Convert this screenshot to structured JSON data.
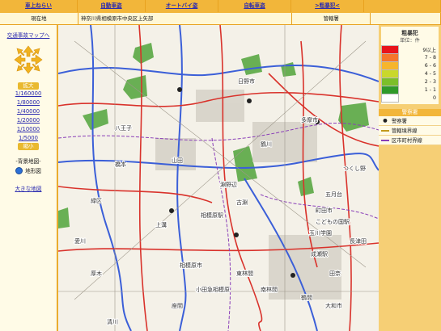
{
  "tabs": [
    "車上ねらい",
    "自動車盗",
    "オートバイ盗",
    "自転車盗",
    ">粗暴犯<"
  ],
  "location": {
    "label": "現在地",
    "value": "神奈川県相模原市中央区上矢部",
    "station_label": "管轄署",
    "station_value": ""
  },
  "sidebar": {
    "back_link": "交通事故マップへ",
    "zoom_in": "拡大",
    "scales": [
      "1/160000",
      "1/80000",
      "1/40000",
      "1/20000",
      "1/10000",
      "1/5000"
    ],
    "zoom_out": "縮小",
    "bg_map_title": "-背景地図-",
    "bg_map_option": "地形図",
    "big_map_link": "大きな地図"
  },
  "legend": {
    "title": "粗暴犯",
    "unit": "単位：件",
    "levels": [
      {
        "label": "9以上",
        "color": "#e8141b"
      },
      {
        "label": "7 - 8",
        "color": "#f5762b"
      },
      {
        "label": "6 - 6",
        "color": "#f6b52c"
      },
      {
        "label": "4 - 5",
        "color": "#c9d82c"
      },
      {
        "label": "2 - 3",
        "color": "#7bbf2a"
      },
      {
        "label": "1 - 1",
        "color": "#2f9a2a"
      },
      {
        "label": "0",
        "color": "#ffffff"
      }
    ],
    "police_title": "警察署",
    "police_items": [
      "警察署",
      "管轄境界線",
      "区市町村界線"
    ]
  },
  "map": {
    "labels": [
      "八王子",
      "日野市",
      "多摩市",
      "町田市",
      "相模原市",
      "玉川学園",
      "成瀬駅",
      "五月台",
      "こどもの国駅",
      "田奈",
      "山田",
      "緑区",
      "相模原駅",
      "座間",
      "大和市",
      "南林間",
      "東林間",
      "小田急相模原",
      "鶴間",
      "厚木",
      "上溝",
      "淵野辺",
      "古淵",
      "鶴川",
      "橋本",
      "清川",
      "愛川",
      "つくし野",
      "長津田"
    ]
  }
}
